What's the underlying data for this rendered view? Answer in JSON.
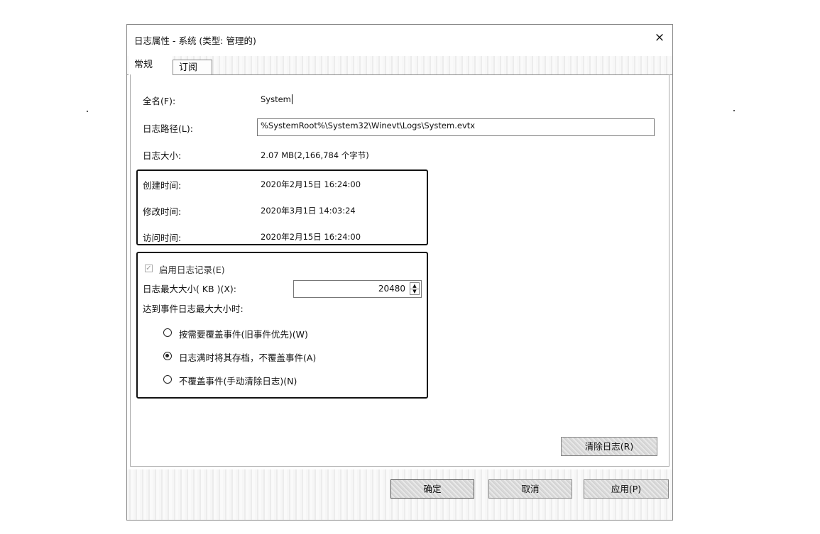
{
  "dialog": {
    "title": "日志属性 - 系统 (类型: 管理的)",
    "close_glyph": "×"
  },
  "tabs": [
    {
      "label": "常规",
      "active": true
    },
    {
      "label": "订阅",
      "active": false
    }
  ],
  "general": {
    "full_name_label": "全名(F):",
    "full_name_value": "System",
    "log_path_label": "日志路径(L):",
    "log_path_value": "%SystemRoot%\\System32\\Winevt\\Logs\\System.evtx",
    "log_size_label": "日志大小:",
    "log_size_value": "2.07 MB(2,166,784 个字节)",
    "created_label": "创建时间:",
    "created_value": "2020年2月15日 16:24:00",
    "modified_label": "修改时间:",
    "modified_value": "2020年3月1日 14:03:24",
    "accessed_label": "访问时间:",
    "accessed_value": "2020年2月15日 16:24:00"
  },
  "logging": {
    "enable_label": "启用日志记录(E)",
    "enable_checked": true,
    "max_size_label": "日志最大大小( KB )(X):",
    "max_size_value": "20480",
    "on_max_label": "达到事件日志最大大小时:",
    "options": [
      {
        "label": "按需要覆盖事件(旧事件优先)(W)",
        "selected": false
      },
      {
        "label": "日志满时将其存档，不覆盖事件(A)",
        "selected": true
      },
      {
        "label": "不覆盖事件(手动清除日志)(N)",
        "selected": false
      }
    ]
  },
  "buttons": {
    "clear_log": "清除日志(R)",
    "ok": "确定",
    "cancel": "取消",
    "apply": "应用(P)"
  },
  "icons": {
    "checkmark": "✓",
    "spin_up": "▲",
    "spin_down": "▼"
  }
}
